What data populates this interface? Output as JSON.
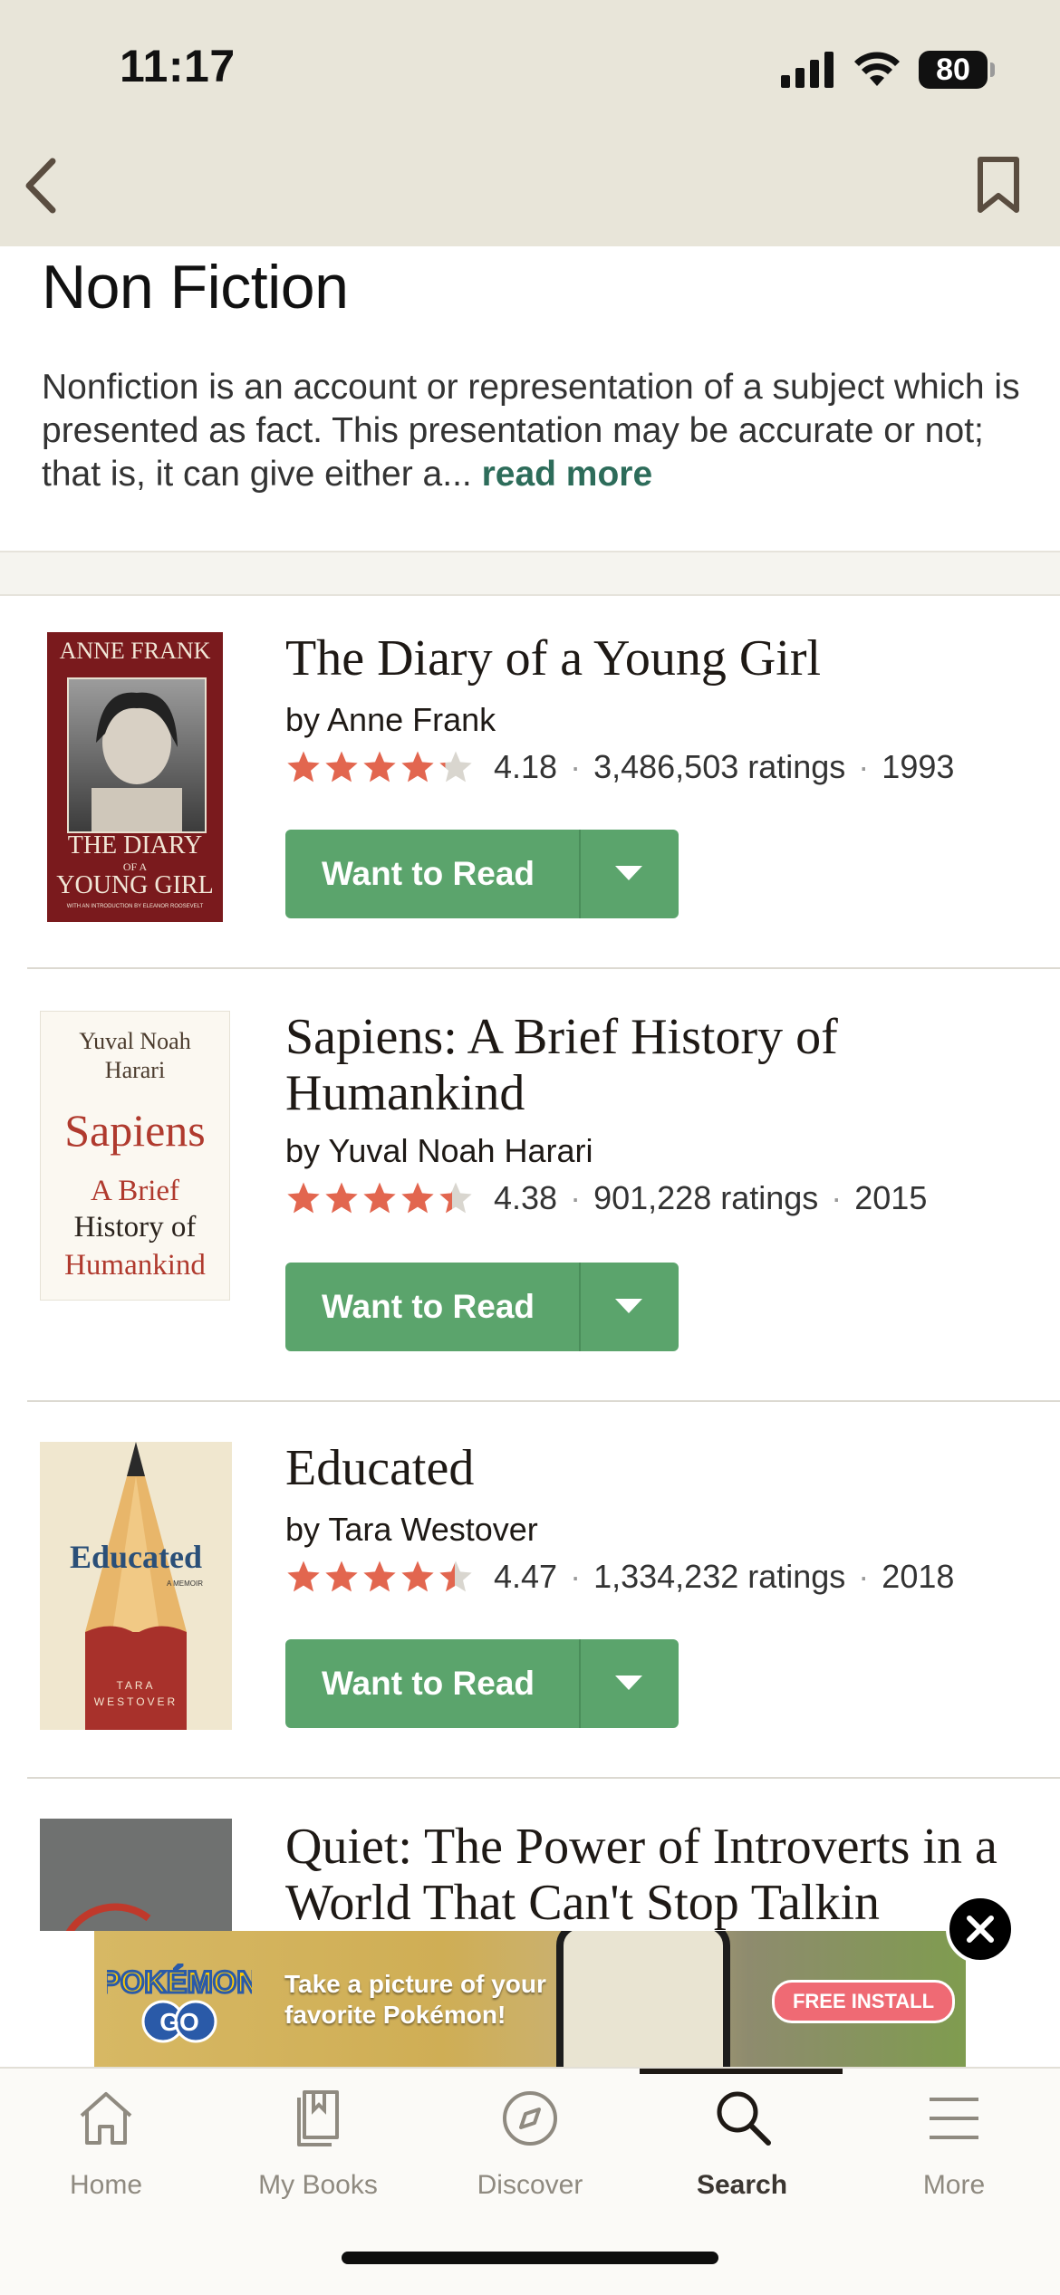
{
  "status_bar": {
    "time": "11:17",
    "battery": "80"
  },
  "genre": {
    "title": "Non Fiction",
    "description": "Nonfiction is an account or representation of a subject which is presented as fact. This presentation may be accurate or not; that is, it can give either a...",
    "read_more": "read more"
  },
  "books": [
    {
      "title": "The Diary of a Young Girl",
      "author": "by Anne Frank",
      "rating": "4.18",
      "rating_value": 4.18,
      "ratings_count": "3,486,503 ratings",
      "year": "1993",
      "button": "Want to Read",
      "cover": {
        "line1": "ANNE FRANK",
        "line2": "THE DIARY",
        "line3": "OF A",
        "line4": "YOUNG GIRL",
        "line5": "WITH AN INTRODUCTION BY ELEANOR ROOSEVELT"
      }
    },
    {
      "title": "Sapiens: A Brief History of Humankind",
      "author": "by Yuval Noah Harari",
      "rating": "4.38",
      "rating_value": 4.38,
      "ratings_count": "901,228 ratings",
      "year": "2015",
      "button": "Want to Read",
      "cover": {
        "line1": "Yuval Noah",
        "line2": "Harari",
        "line3": "Sapiens",
        "line4": "A Brief",
        "line5": "History of",
        "line6": "Humankind"
      }
    },
    {
      "title": "Educated",
      "author": "by Tara Westover",
      "rating": "4.47",
      "rating_value": 4.47,
      "ratings_count": "1,334,232 ratings",
      "year": "2018",
      "button": "Want to Read",
      "cover": {
        "line1": "Educated",
        "line2": "A MEMOIR",
        "line3": "TARA",
        "line4": "WESTOVER"
      }
    },
    {
      "title": "Quiet: The Power of Introverts in a World That Can't Stop Talkin"
    }
  ],
  "ad": {
    "logo_line1": "POKÉMON",
    "logo_line2": "GO",
    "tagline_line1": "Take a picture of your",
    "tagline_line2": "favorite Pokémon!",
    "cta": "FREE INSTALL"
  },
  "tabs": [
    {
      "label": "Home",
      "icon": "home-icon"
    },
    {
      "label": "My Books",
      "icon": "books-icon"
    },
    {
      "label": "Discover",
      "icon": "compass-icon"
    },
    {
      "label": "Search",
      "icon": "search-icon",
      "active": true
    },
    {
      "label": "More",
      "icon": "menu-icon"
    }
  ],
  "colors": {
    "header_bg": "#e8e5d9",
    "accent_green": "#5ba46c",
    "link_green": "#2d6c5a",
    "star": "#e2664f"
  }
}
